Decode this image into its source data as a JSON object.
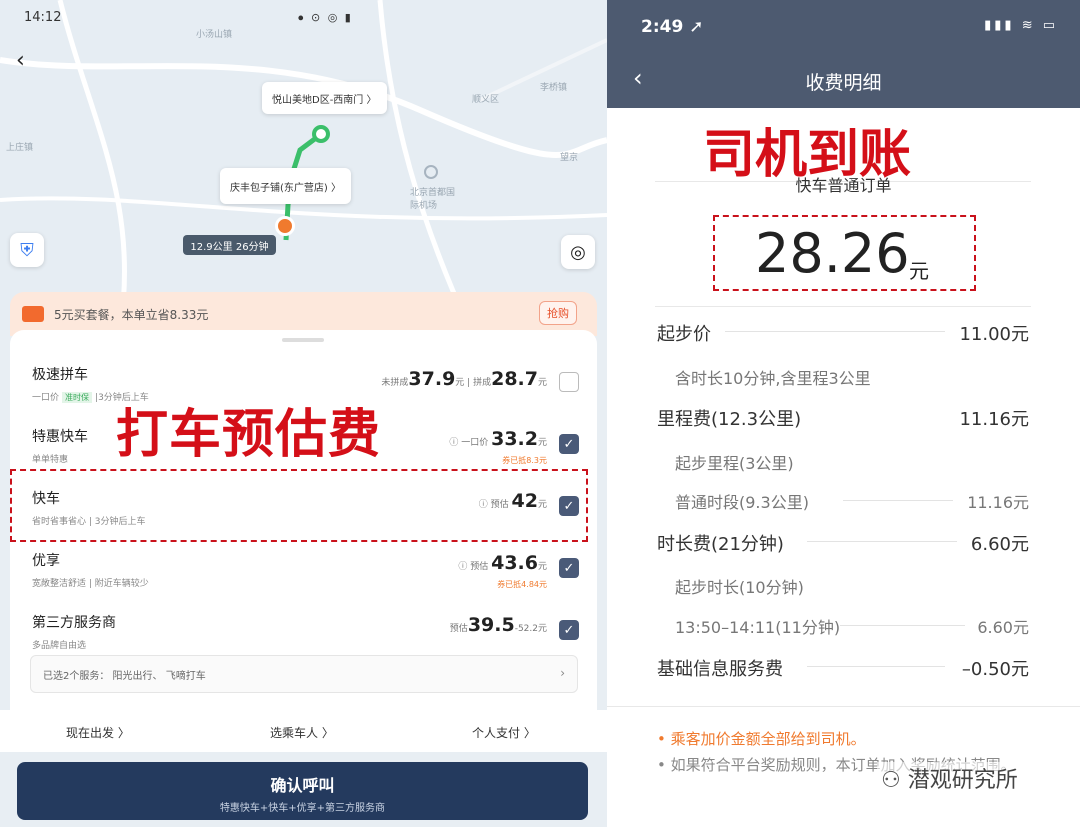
{
  "left": {
    "status": {
      "time": "14:12",
      "icons": "⦁ ⊙ ◎ ▮"
    },
    "map": {
      "labels": [
        {
          "text": "小汤山镇"
        },
        {
          "text": "顺义区"
        },
        {
          "text": "李桥镇"
        },
        {
          "text": "上庄镇"
        },
        {
          "text": "北京首都国际机场"
        },
        {
          "text": "望京"
        }
      ],
      "bubble_destination": "悦山美地D区-西南门 〉",
      "bubble_origin": "庆丰包子铺(东广营店) 〉",
      "route_chip": "12.9公里 26分钟"
    },
    "promo": {
      "text": "5元买套餐，本单立省8.33元",
      "buy": "抢购"
    },
    "cars": [
      {
        "name": "极速拼车",
        "sub_prefix": "一口价",
        "sub_tag": "准时保",
        "sub": "3分钟后上车",
        "price_prefix": "未拼成",
        "price": "37.9",
        "unit": "元",
        "price2_prefix": "拼成",
        "price2": "28.7",
        "price_sub": "",
        "checked": false
      },
      {
        "name": "特惠快车",
        "sub_prefix": "",
        "sub_tag": "",
        "sub": "单单特惠",
        "price_prefix": "ⓘ 一口价",
        "price": "33.2",
        "unit": "元",
        "price2_prefix": "",
        "price2": "",
        "price_sub": "券已抵8.3元",
        "checked": true
      },
      {
        "name": "快车",
        "sub_prefix": "",
        "sub_tag": "",
        "sub": "省时省事省心 | 3分钟后上车",
        "price_prefix": "ⓘ 预估",
        "price": "42",
        "unit": "元",
        "price2_prefix": "",
        "price2": "",
        "price_sub": "",
        "checked": true
      },
      {
        "name": "优享",
        "sub_prefix": "",
        "sub_tag": "",
        "sub": "宽敞整洁舒适 | 附近车辆较少",
        "price_prefix": "ⓘ 预估",
        "price": "43.6",
        "unit": "元",
        "price2_prefix": "",
        "price2": "",
        "price_sub": "券已抵4.84元",
        "checked": true
      },
      {
        "name": "第三方服务商",
        "sub_prefix": "",
        "sub_tag": "",
        "sub": "多品牌自由选",
        "price_prefix": "预估",
        "price": "39.5",
        "unit": "-52.2元",
        "price2_prefix": "",
        "price2": "",
        "price_sub": "",
        "checked": true
      }
    ],
    "services": "已选2个服务：  阳光出行、  飞嘀打车",
    "services_chev": "›",
    "options": {
      "depart": "现在出发 〉",
      "rider": "选乘车人 〉",
      "pay": "个人支付 〉"
    },
    "confirm": {
      "title": "确认呼叫",
      "subtitle": "特惠快车+快车+优享+第三方服务商"
    },
    "overlay": "打车预估费",
    "check_mark": "✓"
  },
  "right": {
    "status": {
      "time": "2:49 ➚",
      "icons": "▮▮▮ ≋ ▭"
    },
    "title": "收费明细",
    "overlay": "司机到账",
    "subtitle": "快车普通订单",
    "amount": "28.26",
    "amount_unit": "元",
    "fees": [
      {
        "label": "起步价",
        "value": "11.00元"
      },
      {
        "label": "里程费(12.3公里)",
        "value": "11.16元"
      },
      {
        "label": "时长费(21分钟)",
        "value": "6.60元"
      },
      {
        "label": "基础信息服务费",
        "value": "–0.50元"
      }
    ],
    "fee_subs": [
      {
        "label": "含时长10分钟,含里程3公里",
        "value": ""
      },
      {
        "label": "起步里程(3公里)",
        "value": ""
      },
      {
        "label": "普通时段(9.3公里)",
        "value": "11.16元"
      },
      {
        "label": "起步时长(10分钟)",
        "value": ""
      },
      {
        "label": "13:50–14:11(11分钟)",
        "value": "6.60元"
      }
    ],
    "note1": "•  乘客加价金额全部给到司机。",
    "note2": "•  如果符合平台奖励规则，本订单加入奖励统计范围。",
    "watermark": "潜观研究所"
  },
  "colors": {
    "accent_red": "#d40f18",
    "brand_navy": "#243a5e",
    "header_gray": "#4d5a70",
    "orange": "#f07a2e"
  }
}
